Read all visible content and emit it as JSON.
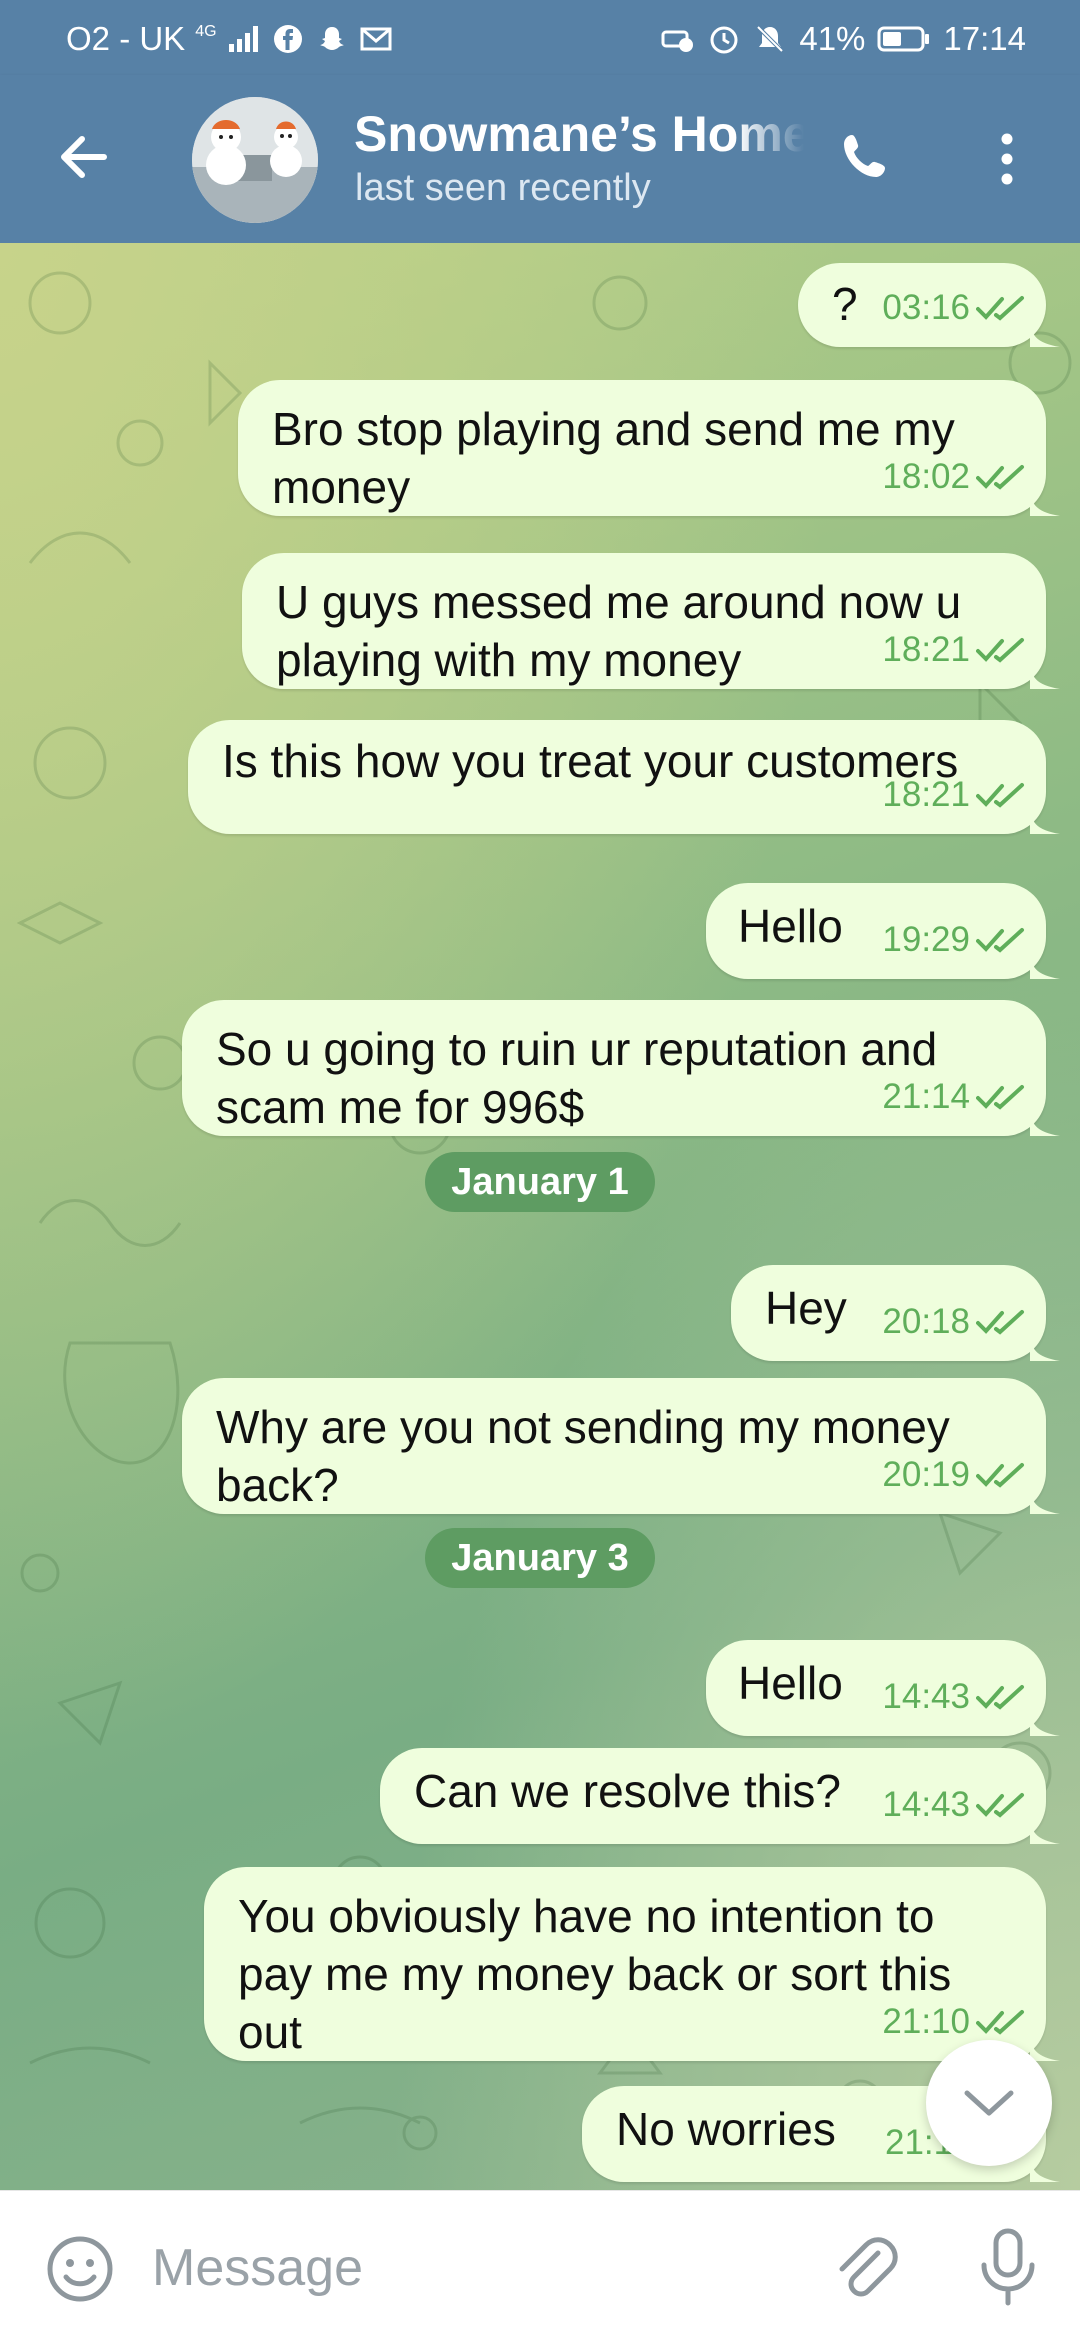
{
  "status_bar": {
    "carrier": "O2 - UK",
    "network": "4G",
    "battery": "41%",
    "time": "17:14"
  },
  "header": {
    "title": "Snowmane’s Home",
    "status": "last seen recently"
  },
  "messages": [
    {
      "text": "?",
      "time": "03:16"
    },
    {
      "text": "Bro stop playing and send me my\nmoney",
      "time": "18:02"
    },
    {
      "text": "U guys messed me around now u\nplaying with my money",
      "time": "18:21"
    },
    {
      "text": "Is this how you treat your customers",
      "time": "18:21"
    },
    {
      "text": "Hello",
      "time": "19:29"
    },
    {
      "text": "So u going to ruin ur reputation and\nscam me for 996$",
      "time": "21:14"
    },
    {
      "text": "Hey",
      "time": "20:18"
    },
    {
      "text": "Why are you not sending my money\nback?",
      "time": "20:19"
    },
    {
      "text": "Hello",
      "time": "14:43"
    },
    {
      "text": "Can we resolve this?",
      "time": "14:43"
    },
    {
      "text": "You obviously have no intention to\npay me my money back or sort this\nout",
      "time": "21:10"
    },
    {
      "text": "No worries",
      "time": "21:11"
    }
  ],
  "date_separators": [
    "January 1",
    "January 3"
  ],
  "composer": {
    "placeholder": "Message"
  },
  "colors": {
    "header": "#5781a6",
    "bubble_out": "#effedd",
    "time_text": "#5fae5a",
    "date_pill": "#5e9c62"
  },
  "icons": [
    "back-arrow-icon",
    "phone-icon",
    "more-vertical-icon",
    "double-check-icon",
    "chevron-down-icon",
    "emoji-icon",
    "paperclip-icon",
    "microphone-icon"
  ]
}
